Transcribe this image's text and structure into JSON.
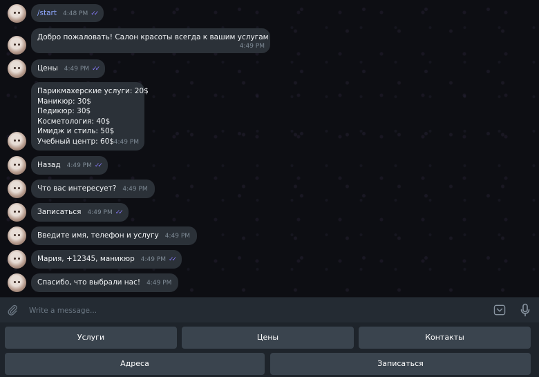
{
  "messages": [
    {
      "text": "/start",
      "time": "4:48 PM",
      "outgoing": true
    },
    {
      "text": "Добро пожаловать! Салон красоты всегда к вашим услугам",
      "time": "4:49 PM",
      "outgoing": false
    },
    {
      "text": "Цены",
      "time": "4:49 PM",
      "outgoing": true
    },
    {
      "lines": [
        "Парикмахерские услуги: 20$",
        "Маникюр: 30$",
        "Педикюр: 30$",
        "Косметология: 40$",
        "Имидж и стиль: 50$",
        "Учебный центр: 60$"
      ],
      "time": "4:49 PM",
      "outgoing": false
    },
    {
      "text": "Назад",
      "time": "4:49 PM",
      "outgoing": true
    },
    {
      "text": "Что вас интересует?",
      "time": "4:49 PM",
      "outgoing": false
    },
    {
      "text": "Записаться",
      "time": "4:49 PM",
      "outgoing": true
    },
    {
      "text": "Введите имя, телефон и услугу",
      "time": "4:49 PM",
      "outgoing": false
    },
    {
      "text": "Мария, +12345, маникюр",
      "time": "4:49 PM",
      "outgoing": true
    },
    {
      "text": "Спасибо, что выбрали нас!",
      "time": "4:49 PM",
      "outgoing": false
    }
  ],
  "composer": {
    "placeholder": "Write a message...",
    "attach_icon": "paperclip-icon",
    "keyboard_icon": "bot-keyboard-icon",
    "mic_icon": "microphone-icon"
  },
  "keyboard": {
    "row1": [
      "Услуги",
      "Цены",
      "Контакты"
    ],
    "row2": [
      "Адреса",
      "Записаться"
    ]
  },
  "colors": {
    "bubble": "#2b3138",
    "read_check": "#8a7cff",
    "command_link": "#8fa8ff",
    "keyboard_button": "#3a444e"
  }
}
